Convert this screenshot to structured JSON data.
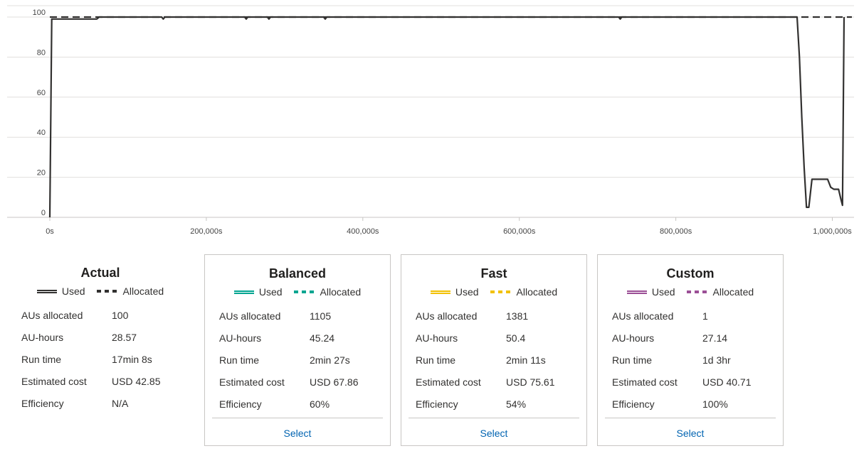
{
  "chart_data": {
    "type": "line",
    "y_ticks": [
      "0",
      "20",
      "40",
      "60",
      "80",
      "100"
    ],
    "x_ticks": [
      "0s",
      "200,000s",
      "400,000s",
      "600,000s",
      "800,000s",
      "1,000,000s"
    ],
    "x_tick_values": [
      0,
      200000,
      400000,
      600000,
      800000,
      1000000
    ],
    "xlim": [
      0,
      1025000
    ],
    "ylim": [
      0,
      100
    ],
    "grid": true,
    "series": [
      {
        "name": "Used",
        "style": "solid",
        "color": "#323130",
        "points": [
          [
            0,
            0
          ],
          [
            2500,
            99
          ],
          [
            60000,
            99
          ],
          [
            63000,
            100
          ],
          [
            143000,
            100
          ],
          [
            145000,
            99
          ],
          [
            147000,
            100
          ],
          [
            249000,
            100
          ],
          [
            251000,
            99
          ],
          [
            253000,
            100
          ],
          [
            278000,
            100
          ],
          [
            280000,
            99
          ],
          [
            282000,
            100
          ],
          [
            350000,
            100
          ],
          [
            352000,
            99
          ],
          [
            354000,
            100
          ],
          [
            727000,
            100
          ],
          [
            729000,
            99
          ],
          [
            731000,
            100
          ],
          [
            955000,
            100
          ],
          [
            958000,
            80
          ],
          [
            961000,
            50
          ],
          [
            964000,
            25
          ],
          [
            967000,
            5
          ],
          [
            970000,
            5
          ],
          [
            974000,
            19
          ],
          [
            994000,
            19
          ],
          [
            998000,
            15
          ],
          [
            1002000,
            14
          ],
          [
            1008000,
            14
          ],
          [
            1011000,
            9
          ],
          [
            1013000,
            6
          ],
          [
            1015000,
            100
          ]
        ]
      },
      {
        "name": "Allocated",
        "style": "dashed",
        "color": "#323130",
        "points": [
          [
            0,
            100
          ],
          [
            1025000,
            100
          ]
        ]
      }
    ]
  },
  "estimates": [
    {
      "title": "Actual",
      "color": "#323130",
      "boxed": false,
      "legend_used": "Used",
      "legend_allocated": "Allocated",
      "rows": [
        {
          "label": "AUs allocated",
          "value": "100"
        },
        {
          "label": "AU-hours",
          "value": "28.57"
        },
        {
          "label": "Run time",
          "value": "17min 8s"
        },
        {
          "label": "Estimated cost",
          "value": "USD 42.85"
        },
        {
          "label": "Efficiency",
          "value": "N/A"
        }
      ]
    },
    {
      "title": "Balanced",
      "color": "#00a591",
      "boxed": true,
      "legend_used": "Used",
      "legend_allocated": "Allocated",
      "rows": [
        {
          "label": "AUs allocated",
          "value": "1105"
        },
        {
          "label": "AU-hours",
          "value": "45.24"
        },
        {
          "label": "Run time",
          "value": "2min 27s"
        },
        {
          "label": "Estimated cost",
          "value": "USD 67.86"
        },
        {
          "label": "Efficiency",
          "value": "60%"
        }
      ],
      "select_label": "Select"
    },
    {
      "title": "Fast",
      "color": "#f2c100",
      "boxed": true,
      "legend_used": "Used",
      "legend_allocated": "Allocated",
      "rows": [
        {
          "label": "AUs allocated",
          "value": "1381"
        },
        {
          "label": "AU-hours",
          "value": "50.4"
        },
        {
          "label": "Run time",
          "value": "2min 11s"
        },
        {
          "label": "Estimated cost",
          "value": "USD 75.61"
        },
        {
          "label": "Efficiency",
          "value": "54%"
        }
      ],
      "select_label": "Select"
    },
    {
      "title": "Custom",
      "color": "#9b4f96",
      "boxed": true,
      "legend_used": "Used",
      "legend_allocated": "Allocated",
      "rows": [
        {
          "label": "AUs allocated",
          "value": "1"
        },
        {
          "label": "AU-hours",
          "value": "27.14"
        },
        {
          "label": "Run time",
          "value": "1d 3hr"
        },
        {
          "label": "Estimated cost",
          "value": "USD 40.71"
        },
        {
          "label": "Efficiency",
          "value": "100%"
        }
      ],
      "select_label": "Select"
    }
  ]
}
